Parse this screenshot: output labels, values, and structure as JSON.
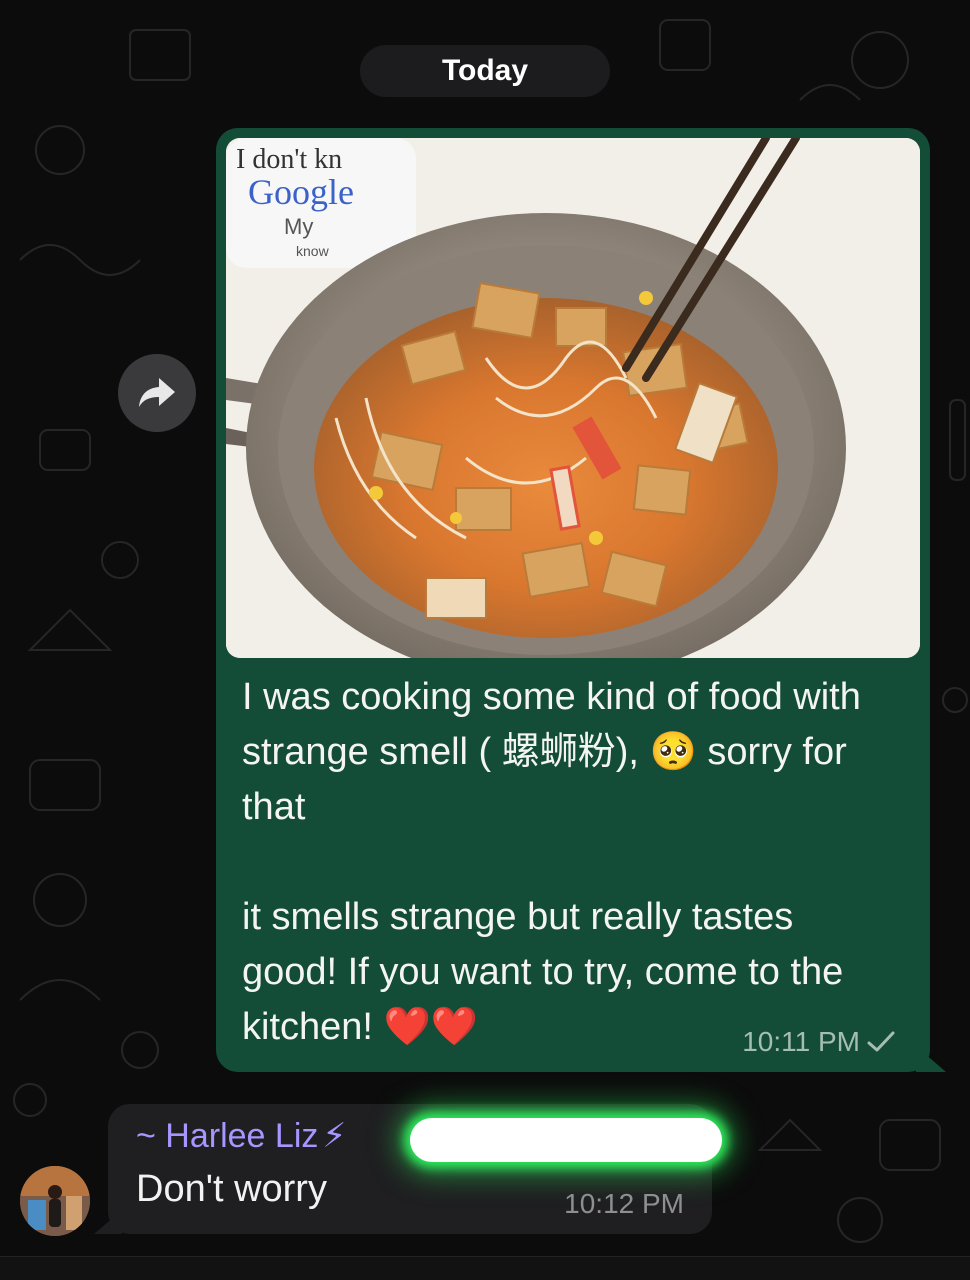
{
  "date_separator": "Today",
  "outgoing": {
    "lines": [
      "I was cooking some kind of food with strange smell ( 螺蛳粉), 🥺 sorry for that",
      "it smells strange but really tastes good!  If you want to try, come to the kitchen! ❤️❤️"
    ],
    "time": "10:11 PM",
    "status_icon": "single-check",
    "photo_mug_text": [
      "I don't kn",
      "Google",
      "My",
      "know"
    ]
  },
  "incoming": {
    "sender": "~ Harlee Liz",
    "sender_emoji": "⚡",
    "text": "Don't worry",
    "time": "10:12 PM"
  },
  "colors": {
    "outgoing_bubble": "#134d37",
    "incoming_bubble": "#1f1f21",
    "sender_name": "#a796ff",
    "highlight_glow": "#2ee65a"
  }
}
